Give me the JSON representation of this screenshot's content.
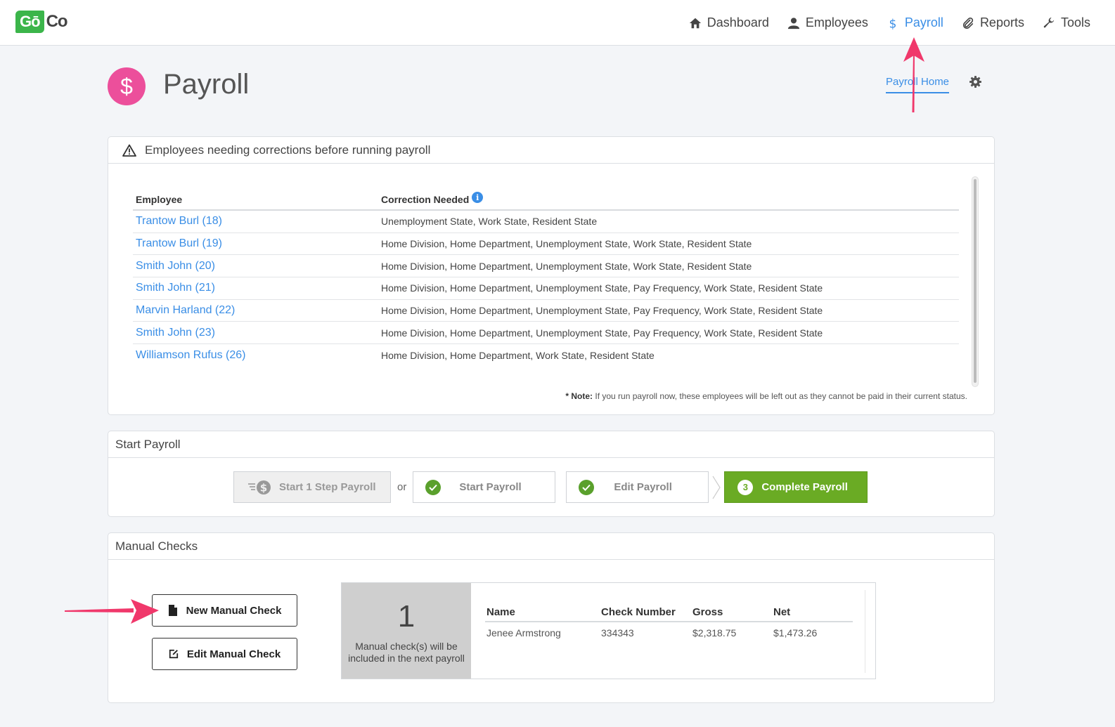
{
  "brand": {
    "logo_go": "Gō",
    "logo_co": "Co"
  },
  "nav": [
    {
      "label": "Dashboard",
      "icon": "home-icon"
    },
    {
      "label": "Employees",
      "icon": "user-icon"
    },
    {
      "label": "Payroll",
      "icon": "dollar-icon",
      "active": true
    },
    {
      "label": "Reports",
      "icon": "paperclip-icon"
    },
    {
      "label": "Tools",
      "icon": "wrench-icon"
    }
  ],
  "page": {
    "title": "Payroll",
    "icon_glyph": "$",
    "home_link": "Payroll Home"
  },
  "corrections": {
    "title": "Employees needing corrections before running payroll",
    "col_employee": "Employee",
    "col_correction": "Correction Needed",
    "rows": [
      {
        "employee": "Trantow Burl (18)",
        "correction": "Unemployment State, Work State, Resident State"
      },
      {
        "employee": "Trantow Burl (19)",
        "correction": "Home Division, Home Department, Unemployment State, Work State, Resident State"
      },
      {
        "employee": "Smith John (20)",
        "correction": "Home Division, Home Department, Unemployment State, Work State, Resident State"
      },
      {
        "employee": "Smith John (21)",
        "correction": "Home Division, Home Department, Unemployment State, Pay Frequency, Work State, Resident State"
      },
      {
        "employee": "Marvin Harland (22)",
        "correction": "Home Division, Home Department, Unemployment State, Pay Frequency, Work State, Resident State"
      },
      {
        "employee": "Smith John (23)",
        "correction": "Home Division, Home Department, Unemployment State, Pay Frequency, Work State, Resident State"
      },
      {
        "employee": "Williamson Rufus (26)",
        "correction": "Home Division, Home Department, Work State, Resident State"
      }
    ],
    "note_label": "* Note:",
    "note_text": " If you run payroll now, these employees will be left out as they cannot be paid in their current status."
  },
  "start_payroll": {
    "title": "Start Payroll",
    "one_step": "Start 1 Step Payroll",
    "or": "or",
    "start": "Start Payroll",
    "edit": "Edit Payroll",
    "complete": "Complete Payroll",
    "complete_step": "3"
  },
  "manual_checks": {
    "title": "Manual Checks",
    "new_button": "New Manual Check",
    "edit_button": "Edit Manual Check",
    "count": "1",
    "count_text": "Manual check(s) will be included in the next payroll",
    "columns": [
      "Name",
      "Check Number",
      "Gross",
      "Net"
    ],
    "rows": [
      {
        "name": "Jenee Armstrong",
        "check_number": "334343",
        "gross": "$2,318.75",
        "net": "$1,473.26"
      }
    ]
  },
  "colors": {
    "accent": "#3a8ee6",
    "brand_green": "#3bb54a",
    "payroll_pink": "#ec4f9b",
    "complete_green": "#6aab24",
    "annotation_arrow": "#f0386b"
  }
}
